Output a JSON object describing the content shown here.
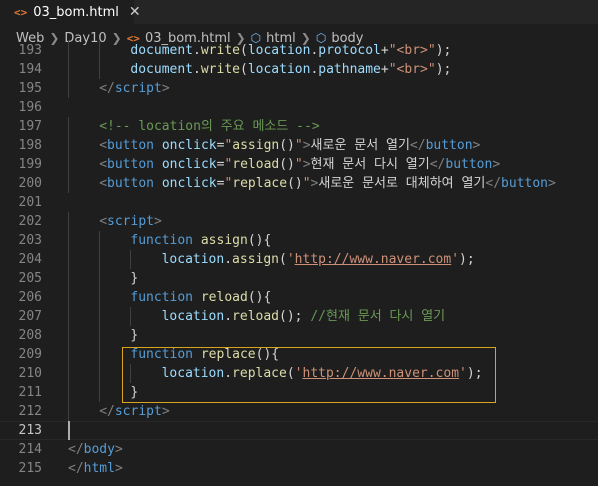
{
  "tab": {
    "icon": "<>",
    "filename": "03_bom.html",
    "close": "✕"
  },
  "breadcrumb": {
    "items": [
      "Web",
      "Day10",
      "03_bom.html",
      "html",
      "body"
    ],
    "tag_icon": "<>"
  },
  "editor": {
    "lines": [
      {
        "num": "193",
        "tokens": [
          [
            "t-var",
            "document"
          ],
          [
            "t-text",
            "."
          ],
          [
            "t-fn",
            "write"
          ],
          [
            "t-text",
            "("
          ],
          [
            "t-var",
            "location"
          ],
          [
            "t-text",
            "."
          ],
          [
            "t-var",
            "protocol"
          ],
          [
            "t-text",
            "+"
          ],
          [
            "t-str",
            "\"<br>\""
          ],
          [
            "t-text",
            ");"
          ]
        ]
      },
      {
        "num": "194",
        "tokens": [
          [
            "t-var",
            "document"
          ],
          [
            "t-text",
            "."
          ],
          [
            "t-fn",
            "write"
          ],
          [
            "t-text",
            "("
          ],
          [
            "t-var",
            "location"
          ],
          [
            "t-text",
            "."
          ],
          [
            "t-var",
            "pathname"
          ],
          [
            "t-text",
            "+"
          ],
          [
            "t-str",
            "\"<br>\""
          ],
          [
            "t-text",
            ");"
          ]
        ]
      },
      {
        "num": "195",
        "tokens": [
          [
            "t-br",
            "</"
          ],
          [
            "t-tag",
            "script"
          ],
          [
            "t-br",
            ">"
          ]
        ]
      },
      {
        "num": "196",
        "tokens": []
      },
      {
        "num": "197",
        "tokens": [
          [
            "t-com",
            "<!-- location의 주요 메소드 -->"
          ]
        ]
      },
      {
        "num": "198",
        "tokens": [
          [
            "t-br",
            "<"
          ],
          [
            "t-tag",
            "button"
          ],
          [
            "t-text",
            " "
          ],
          [
            "t-attr",
            "onclick"
          ],
          [
            "t-text",
            "="
          ],
          [
            "t-str",
            "\""
          ],
          [
            "t-fn",
            "assign"
          ],
          [
            "t-text",
            "()"
          ],
          [
            "t-str",
            "\""
          ],
          [
            "t-br",
            ">"
          ],
          [
            "t-text",
            "새로운 문서 열기"
          ],
          [
            "t-br",
            "</"
          ],
          [
            "t-tag",
            "button"
          ],
          [
            "t-br",
            ">"
          ]
        ]
      },
      {
        "num": "199",
        "tokens": [
          [
            "t-br",
            "<"
          ],
          [
            "t-tag",
            "button"
          ],
          [
            "t-text",
            " "
          ],
          [
            "t-attr",
            "onclick"
          ],
          [
            "t-text",
            "="
          ],
          [
            "t-str",
            "\""
          ],
          [
            "t-fn",
            "reload"
          ],
          [
            "t-text",
            "()"
          ],
          [
            "t-str",
            "\""
          ],
          [
            "t-br",
            ">"
          ],
          [
            "t-text",
            "현재 문서 다시 열기"
          ],
          [
            "t-br",
            "</"
          ],
          [
            "t-tag",
            "button"
          ],
          [
            "t-br",
            ">"
          ]
        ]
      },
      {
        "num": "200",
        "tokens": [
          [
            "t-br",
            "<"
          ],
          [
            "t-tag",
            "button"
          ],
          [
            "t-text",
            " "
          ],
          [
            "t-attr",
            "onclick"
          ],
          [
            "t-text",
            "="
          ],
          [
            "t-str",
            "\""
          ],
          [
            "t-fn",
            "replace"
          ],
          [
            "t-text",
            "()"
          ],
          [
            "t-str",
            "\""
          ],
          [
            "t-br",
            ">"
          ],
          [
            "t-text",
            "새로운 문서로 대체하여 열기"
          ],
          [
            "t-br",
            "</"
          ],
          [
            "t-tag",
            "button"
          ],
          [
            "t-br",
            ">"
          ]
        ]
      },
      {
        "num": "201",
        "tokens": []
      },
      {
        "num": "202",
        "tokens": [
          [
            "t-br",
            "<"
          ],
          [
            "t-tag",
            "script"
          ],
          [
            "t-br",
            ">"
          ]
        ]
      },
      {
        "num": "203",
        "tokens": [
          [
            "t-kw",
            "function"
          ],
          [
            "t-text",
            " "
          ],
          [
            "t-fn",
            "assign"
          ],
          [
            "t-text",
            "(){"
          ]
        ]
      },
      {
        "num": "204",
        "tokens": [
          [
            "t-var",
            "location"
          ],
          [
            "t-text",
            "."
          ],
          [
            "t-fn",
            "assign"
          ],
          [
            "t-text",
            "("
          ],
          [
            "t-str",
            "'"
          ],
          [
            "t-url",
            "http://www.naver.com"
          ],
          [
            "t-str",
            "'"
          ],
          [
            "t-text",
            ");"
          ]
        ]
      },
      {
        "num": "205",
        "tokens": [
          [
            "t-text",
            "}"
          ]
        ]
      },
      {
        "num": "206",
        "tokens": [
          [
            "t-kw",
            "function"
          ],
          [
            "t-text",
            " "
          ],
          [
            "t-fn",
            "reload"
          ],
          [
            "t-text",
            "(){"
          ]
        ]
      },
      {
        "num": "207",
        "tokens": [
          [
            "t-var",
            "location"
          ],
          [
            "t-text",
            "."
          ],
          [
            "t-fn",
            "reload"
          ],
          [
            "t-text",
            "(); "
          ],
          [
            "t-com",
            "//현재 문서 다시 열기"
          ]
        ]
      },
      {
        "num": "208",
        "tokens": [
          [
            "t-text",
            "}"
          ]
        ]
      },
      {
        "num": "209",
        "tokens": [
          [
            "t-kw",
            "function"
          ],
          [
            "t-text",
            " "
          ],
          [
            "t-fn",
            "replace"
          ],
          [
            "t-text",
            "(){"
          ]
        ]
      },
      {
        "num": "210",
        "tokens": [
          [
            "t-var",
            "location"
          ],
          [
            "t-text",
            "."
          ],
          [
            "t-fn",
            "replace"
          ],
          [
            "t-text",
            "("
          ],
          [
            "t-str",
            "'"
          ],
          [
            "t-url",
            "http://www.naver.com"
          ],
          [
            "t-str",
            "'"
          ],
          [
            "t-text",
            ");"
          ]
        ]
      },
      {
        "num": "211",
        "tokens": [
          [
            "t-text",
            "}"
          ]
        ]
      },
      {
        "num": "212",
        "tokens": [
          [
            "t-br",
            "</"
          ],
          [
            "t-tag",
            "script"
          ],
          [
            "t-br",
            ">"
          ]
        ]
      },
      {
        "num": "213",
        "tokens": []
      },
      {
        "num": "214",
        "tokens": [
          [
            "t-br",
            "</"
          ],
          [
            "t-tag",
            "body"
          ],
          [
            "t-br",
            ">"
          ]
        ]
      },
      {
        "num": "215",
        "tokens": [
          [
            "t-br",
            "</"
          ],
          [
            "t-tag",
            "html"
          ],
          [
            "t-br",
            ">"
          ]
        ]
      }
    ]
  }
}
